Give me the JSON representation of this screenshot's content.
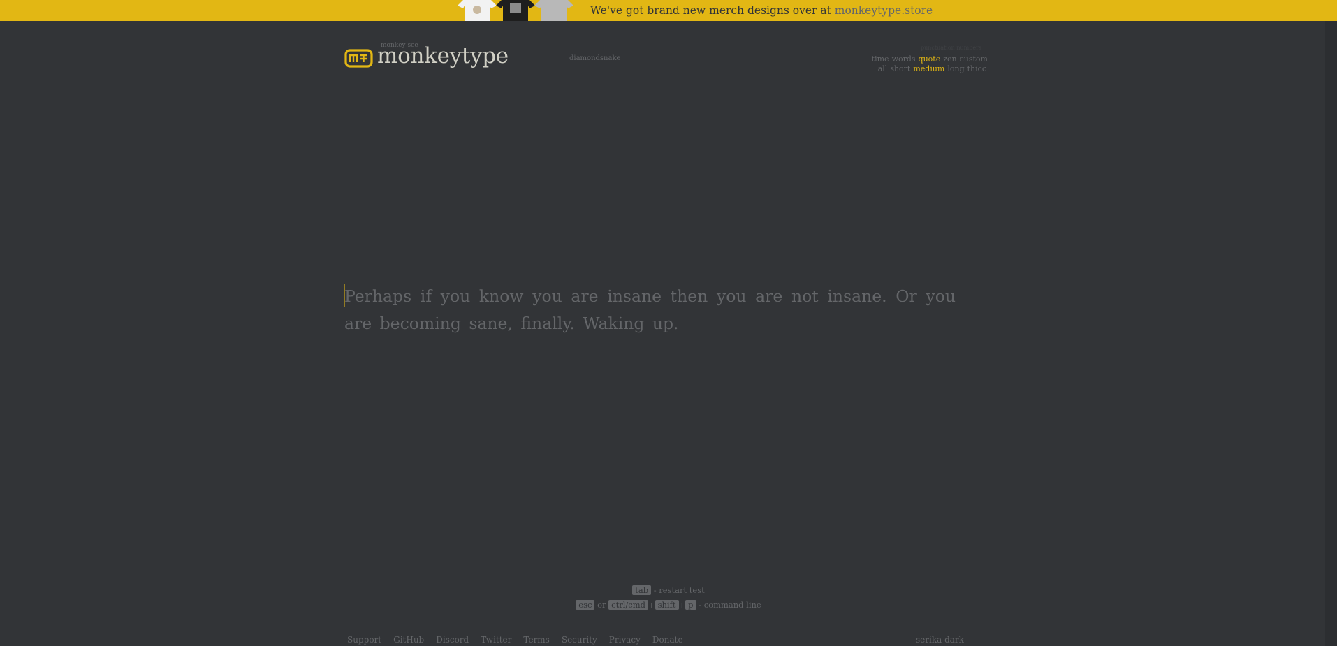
{
  "banner": {
    "text": "We've got brand new merch designs over at ",
    "link": "monkeytype.store"
  },
  "logo": {
    "top_text": "monkey see",
    "text": "monkeytype"
  },
  "account": {
    "name": "diamondsnake"
  },
  "config": {
    "faint_text": "punctuation numbers",
    "modes": [
      "time",
      "words",
      "quote",
      "zen",
      "custom"
    ],
    "active_mode": "quote",
    "lengths": [
      "all",
      "short",
      "medium",
      "long",
      "thicc"
    ],
    "active_length": "medium"
  },
  "test": {
    "words_text": "Perhaps if you know you are insane then you are not insane. Or you are becoming sane, finally. Waking up."
  },
  "hints": {
    "restart_key": "tab",
    "restart_text": " - restart test",
    "esc_key": "esc",
    "or_text": " or ",
    "ctrl_key": "ctrl/cmd",
    "plus1": "+",
    "shift_key": "shift",
    "plus2": "+",
    "p_key": "p",
    "command_text": " - command line"
  },
  "footer": {
    "links": [
      "Support",
      "GitHub",
      "Discord",
      "Twitter",
      "Terms",
      "Security",
      "Privacy",
      "Donate"
    ],
    "theme": "serika dark"
  },
  "colors": {
    "background": "#323437",
    "main": "#e2b714",
    "sub": "#646669",
    "text": "#d1d0c5"
  }
}
